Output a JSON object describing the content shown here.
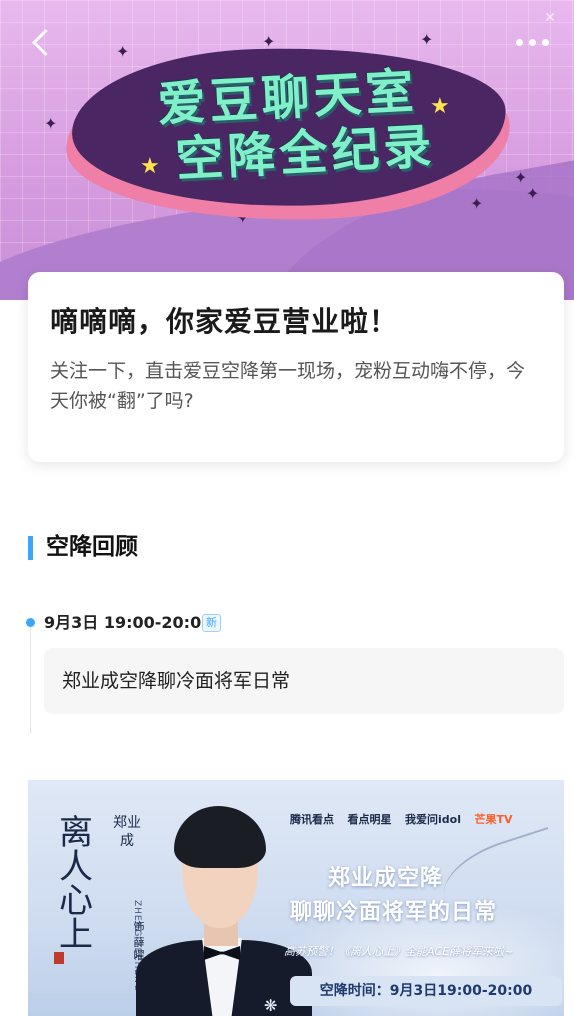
{
  "banner": {
    "title_line1": "爱豆聊天室",
    "title_line2": "空降全纪录"
  },
  "nav": {
    "back_icon": "chevron-left-icon",
    "more_icon": "ellipsis-icon"
  },
  "intro": {
    "title": "嘀嘀嘀，你家爱豆营业啦！",
    "description": "关注一下，直击爱豆空降第一现场，宠粉互动嗨不停，今天你被“翻”了吗?"
  },
  "section": {
    "title": "空降回顾"
  },
  "timeline": [
    {
      "time": "9月3日 19:00-20:00",
      "badge": "新",
      "text": "郑业成空降聊冷面将军日常"
    }
  ],
  "poster": {
    "drama_title": "离人心上",
    "actor_name": "郑业成",
    "actor_pinyin": "ZHENG YECHENG",
    "role_prefix": "饰",
    "role_name": "薛曜",
    "logos": [
      "腾讯看点",
      "看点明星",
      "我爱问idol",
      "芒果TV"
    ],
    "headline_1": "郑业成空降",
    "headline_2": "聊聊冷面将军的日常",
    "subline": "高苏预警！《离人心上》全能ACE薛将军来啦~",
    "airtime": "空降时间：9月3日19:00-20:00"
  },
  "colors": {
    "accent": "#3aa7ff",
    "banner_bg": "#d79de0",
    "banner_text": "#7ff0c8",
    "blob": "#4a2663"
  }
}
